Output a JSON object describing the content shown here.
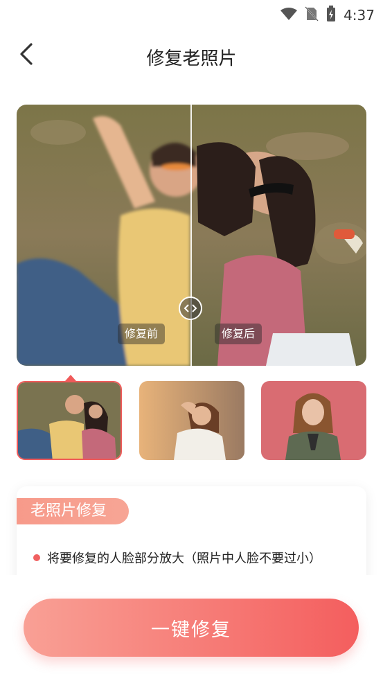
{
  "status": {
    "time": "4:37",
    "icons": [
      "wifi-icon",
      "no-sim-icon",
      "battery-charging-icon"
    ]
  },
  "nav": {
    "title": "修复老照片",
    "back_icon": "chevron-left-icon"
  },
  "compare": {
    "before_label": "修复前",
    "after_label": "修复后",
    "handle_icon": "left-right-arrows-icon"
  },
  "thumbnails": [
    {
      "name": "thumb-friends-grass",
      "selected": true
    },
    {
      "name": "thumb-girl-sunset",
      "selected": false
    },
    {
      "name": "thumb-girl-pink-wall",
      "selected": false
    }
  ],
  "card": {
    "tag_label": "老照片修复",
    "tip": "将要修复的人脸部分放大（照片中人脸不要过小）"
  },
  "action": {
    "button_label": "一键修复"
  },
  "colors": {
    "accent": "#f45e5e",
    "accent_light": "#f9a095"
  }
}
